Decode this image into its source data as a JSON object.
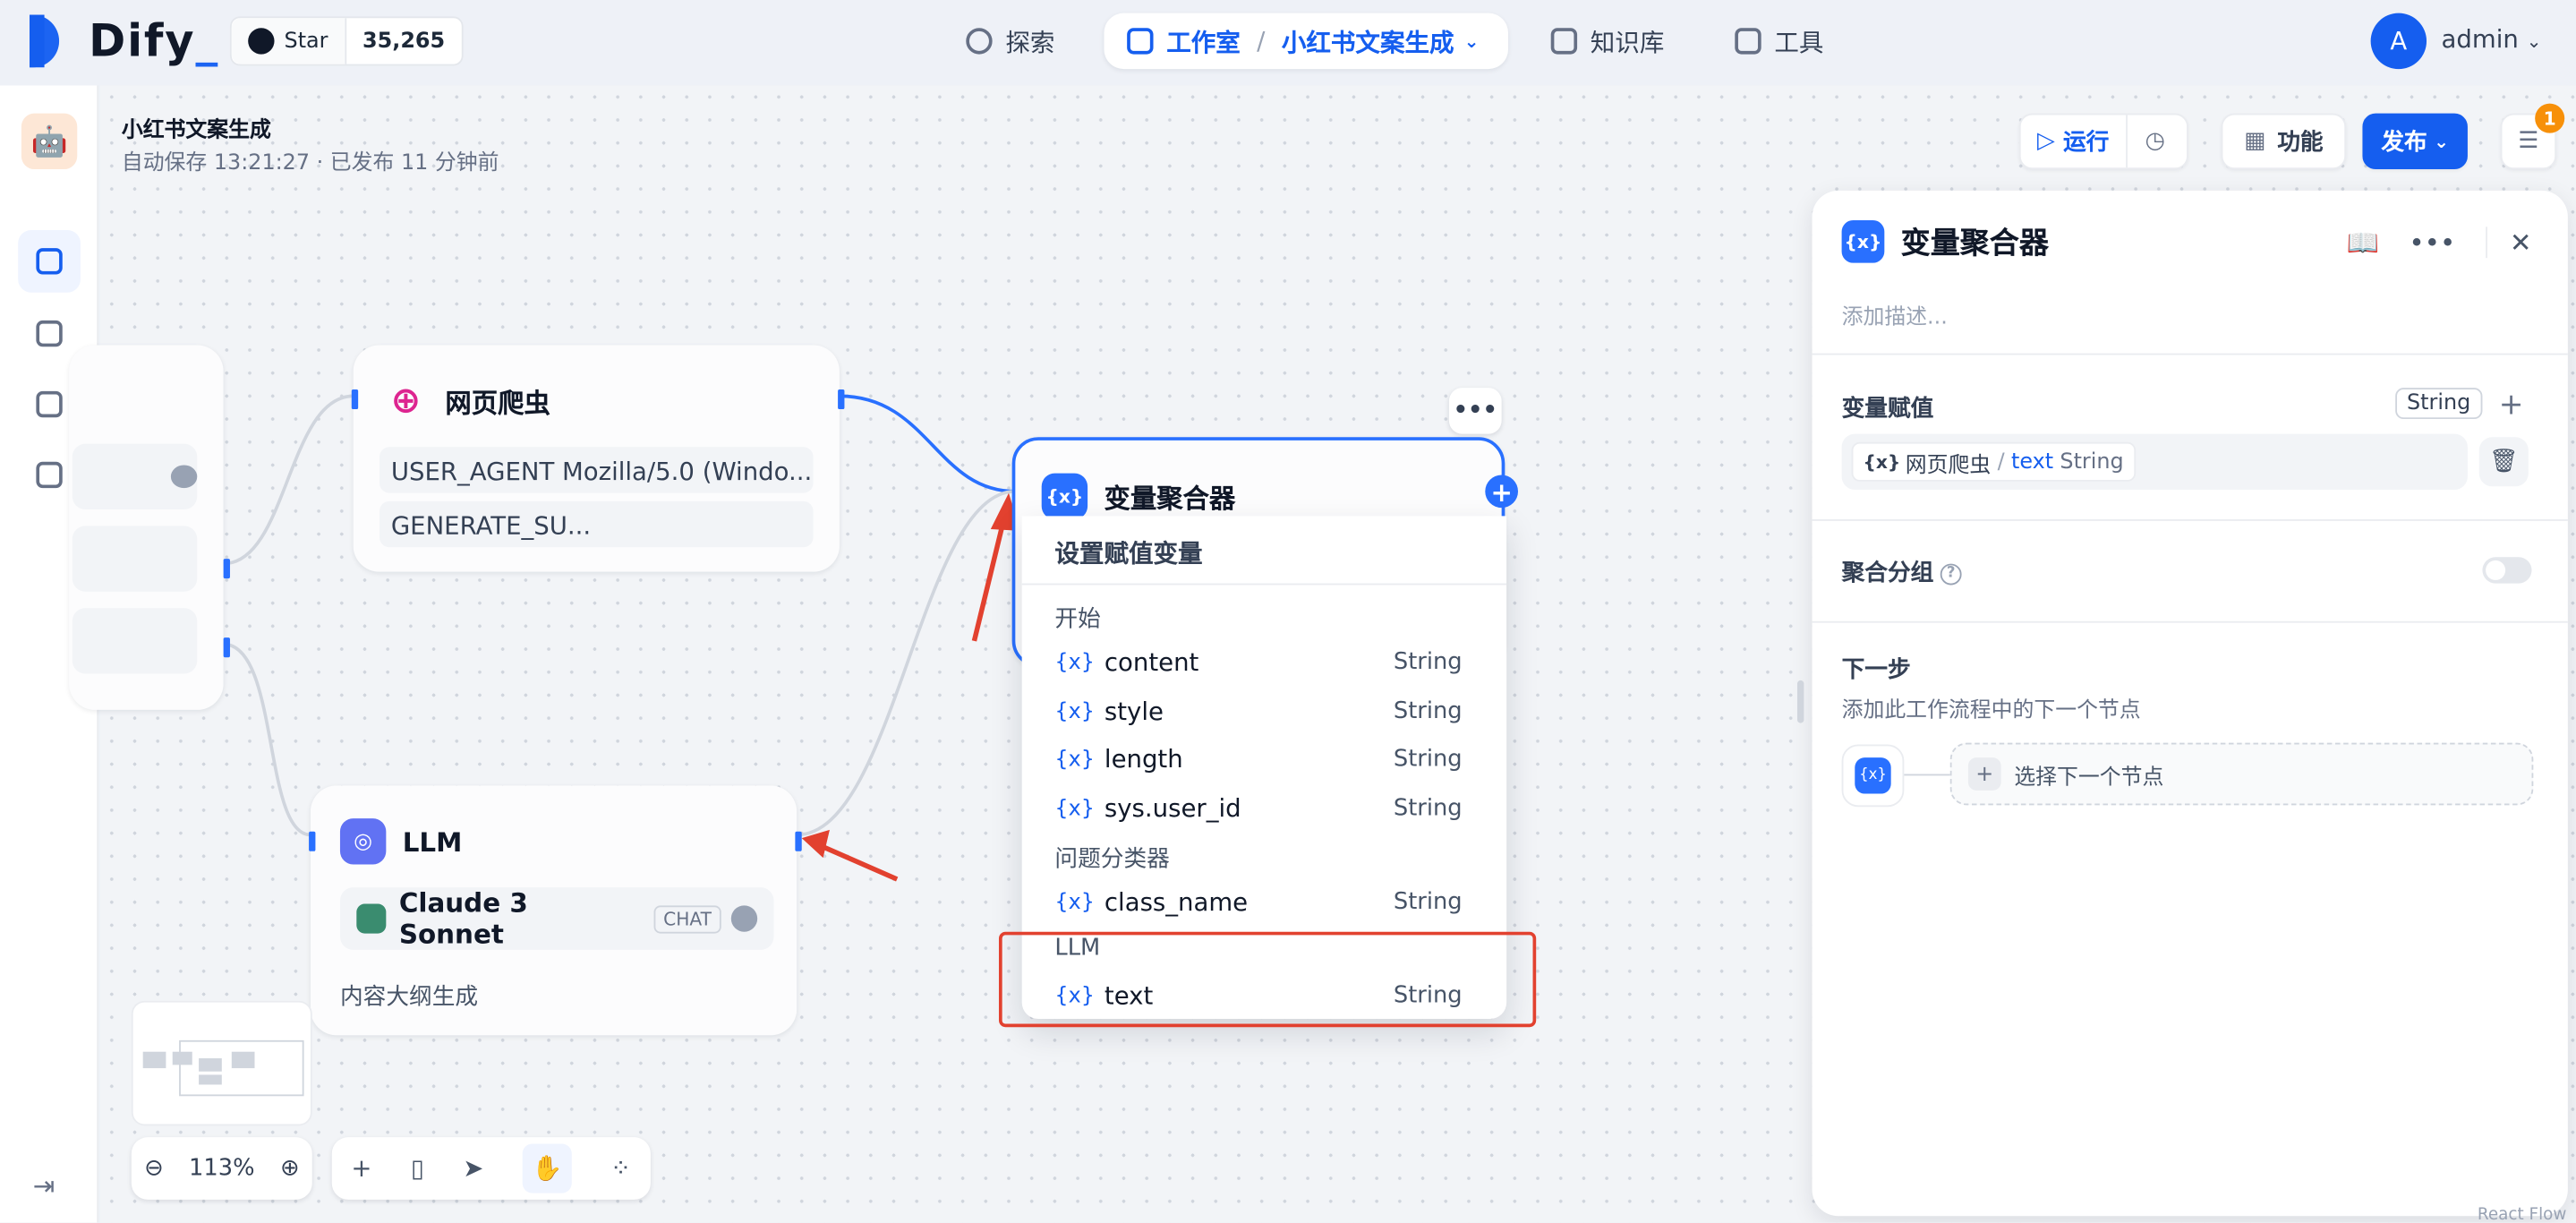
{
  "brand": {
    "name": "Dify",
    "suffix": "_"
  },
  "github": {
    "label": "Star",
    "count": "35,265"
  },
  "nav": {
    "explore": "探索",
    "studio": "工作室",
    "sep": "/",
    "current_app": "小红书文案生成",
    "knowledge": "知识库",
    "tools": "工具"
  },
  "user": {
    "avatar_letter": "A",
    "name": "admin"
  },
  "app": {
    "title": "小红书文案生成",
    "autosave": "自动保存 13:21:27 · 已发布 11 分钟前"
  },
  "toolbar": {
    "run": "运行",
    "features": "功能",
    "publish": "发布",
    "checklist_count": "1"
  },
  "nodes": {
    "scraper": {
      "title": "网页爬虫",
      "fields": [
        "USER_AGENT Mozilla/5.0 (Windo...",
        "GENERATE_SU..."
      ]
    },
    "llm": {
      "title": "LLM",
      "model": "Claude 3 Sonnet",
      "mode": "CHAT",
      "desc": "内容大纲生成"
    },
    "aggregator": {
      "title": "变量聚合器",
      "more": "•••",
      "add": "+"
    }
  },
  "picker": {
    "header": "设置赋值变量",
    "groups": [
      {
        "name": "开始",
        "vars": [
          {
            "name": "content",
            "type": "String"
          },
          {
            "name": "style",
            "type": "String"
          },
          {
            "name": "length",
            "type": "String"
          },
          {
            "name": "sys.user_id",
            "type": "String"
          }
        ]
      },
      {
        "name": "问题分类器",
        "vars": [
          {
            "name": "class_name",
            "type": "String"
          }
        ]
      },
      {
        "name": "LLM",
        "vars": [
          {
            "name": "text",
            "type": "String"
          }
        ]
      }
    ],
    "var_prefix": "{x}"
  },
  "panel": {
    "title": "变量聚合器",
    "desc_placeholder": "添加描述...",
    "assign_label": "变量赋值",
    "assign_type": "String",
    "assigned_var": {
      "node": "网页爬虫",
      "var": "text",
      "type": "String"
    },
    "group_label": "聚合分组",
    "next_label": "下一步",
    "next_desc": "添加此工作流程中的下一个节点",
    "next_select": "选择下一个节点"
  },
  "zoom": {
    "level": "113%"
  },
  "footer": {
    "reactflow": "React Flow"
  },
  "colors": {
    "accent": "#155eef",
    "highlight_box": "#e2412f",
    "arrow": "#e2412f"
  }
}
